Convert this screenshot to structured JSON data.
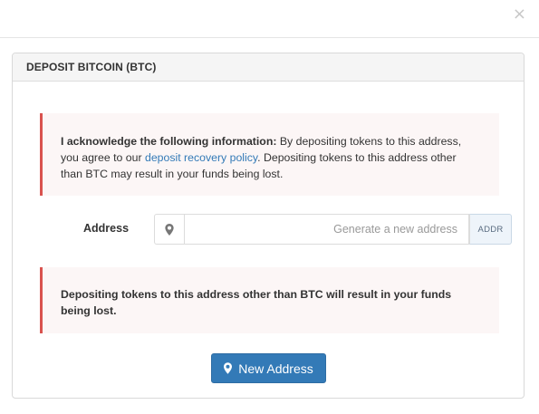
{
  "modal": {
    "close_glyph": "×"
  },
  "panel": {
    "title": "DEPOSIT BITCOIN (BTC)"
  },
  "notice": {
    "strong": "I acknowledge the following information:",
    "text_before_link": " By depositing tokens to this address, you agree to our ",
    "link": "deposit recovery policy",
    "text_after_link": ". Depositing tokens to this address other than BTC may result in your funds being lost."
  },
  "address": {
    "label": "Address",
    "value": "",
    "placeholder": "Generate a new address",
    "addon": "ADDR",
    "icon": "map-marker-icon"
  },
  "warning": {
    "text": "Depositing tokens to this address other than BTC will result in your funds being lost."
  },
  "button": {
    "label": "New Address",
    "icon": "map-marker-icon"
  },
  "colors": {
    "accent": "#337ab7",
    "alert_border": "#d9534f",
    "alert_bg": "#fcf6f6"
  }
}
